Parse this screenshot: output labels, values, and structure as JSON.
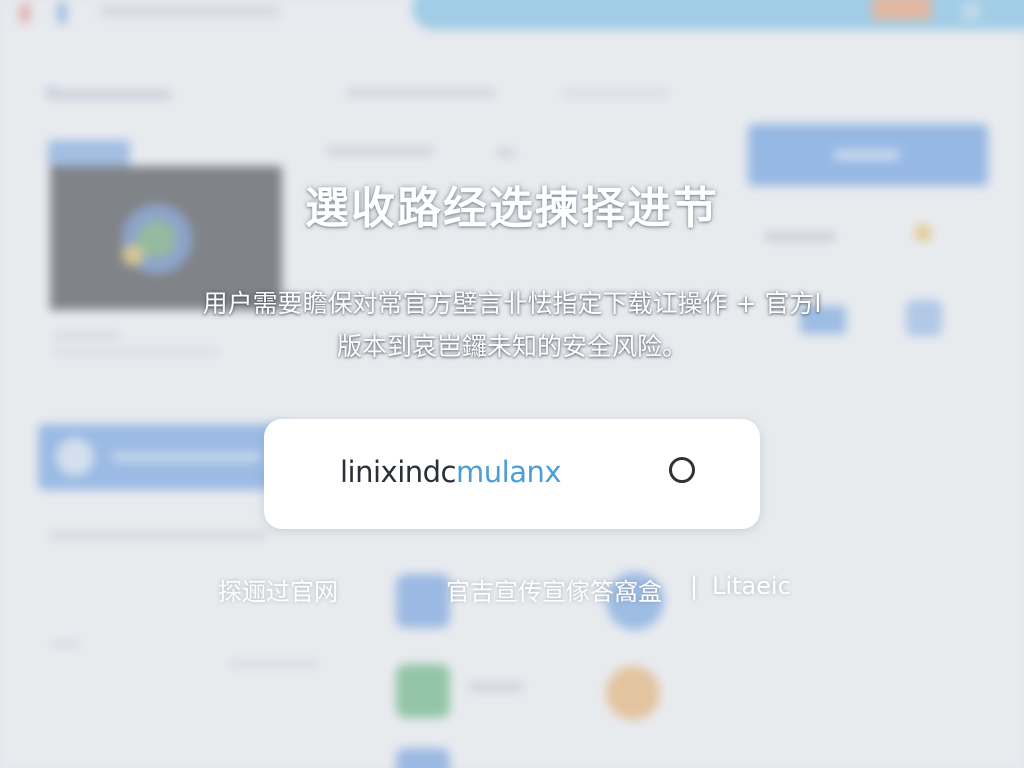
{
  "dialog": {
    "title": "選收路经选揀择进节",
    "description_line1": "用户需要瞻保対常官方壁言卝怯指定下载讧操作 + 官方l",
    "description_line2": "版本到哀岜鑼未知的安全风险。",
    "url_part1": "linixindc",
    "url_part2": "mulanx"
  },
  "links": {
    "left": "探逦过官网",
    "middle": "官吉宣传宣傢答窩盒",
    "separator": "|",
    "right": "Litaeic"
  },
  "colors": {
    "url_accent": "#4a9fd6",
    "background_blue": "#3f86e0"
  }
}
